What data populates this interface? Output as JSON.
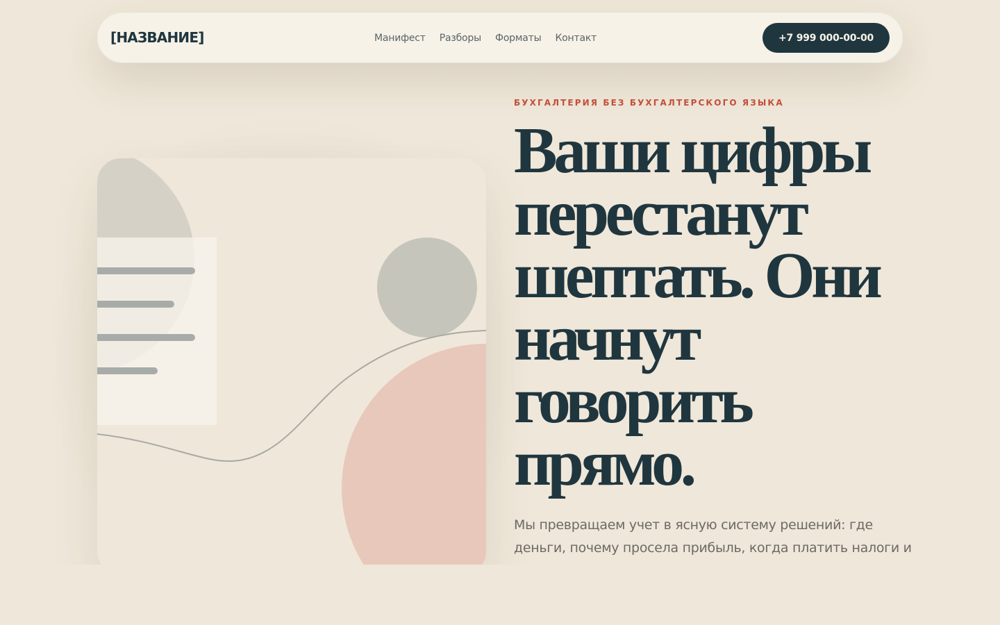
{
  "header": {
    "logo": "[НАЗВАНИЕ]",
    "nav": [
      {
        "label": "Манифест"
      },
      {
        "label": "Разборы"
      },
      {
        "label": "Форматы"
      },
      {
        "label": "Контакт"
      }
    ],
    "phone_button": "+7 999 000-00-00"
  },
  "hero": {
    "eyebrow": "БУХГАЛТЕРИЯ БЕЗ БУХГАЛТЕРСКОГО ЯЗЫКА",
    "headline": "Ваши цифры перестанут шептать. Они начнут говорить прямо.",
    "lead": "Мы превращаем учет в ясную систему решений: где деньги, почему просела прибыль, когда платить налоги и что делать дальше."
  },
  "colors": {
    "background": "#efe7d9",
    "header_bg": "#f6f2e8",
    "ink": "#20363f",
    "accent": "#c6503c",
    "muted_text": "#6c6a66",
    "shape_grey": "#c5c5bb",
    "shape_peach": "#e8c8ba",
    "paper": "#f7f3ec",
    "line_grey": "#a7aca9"
  }
}
